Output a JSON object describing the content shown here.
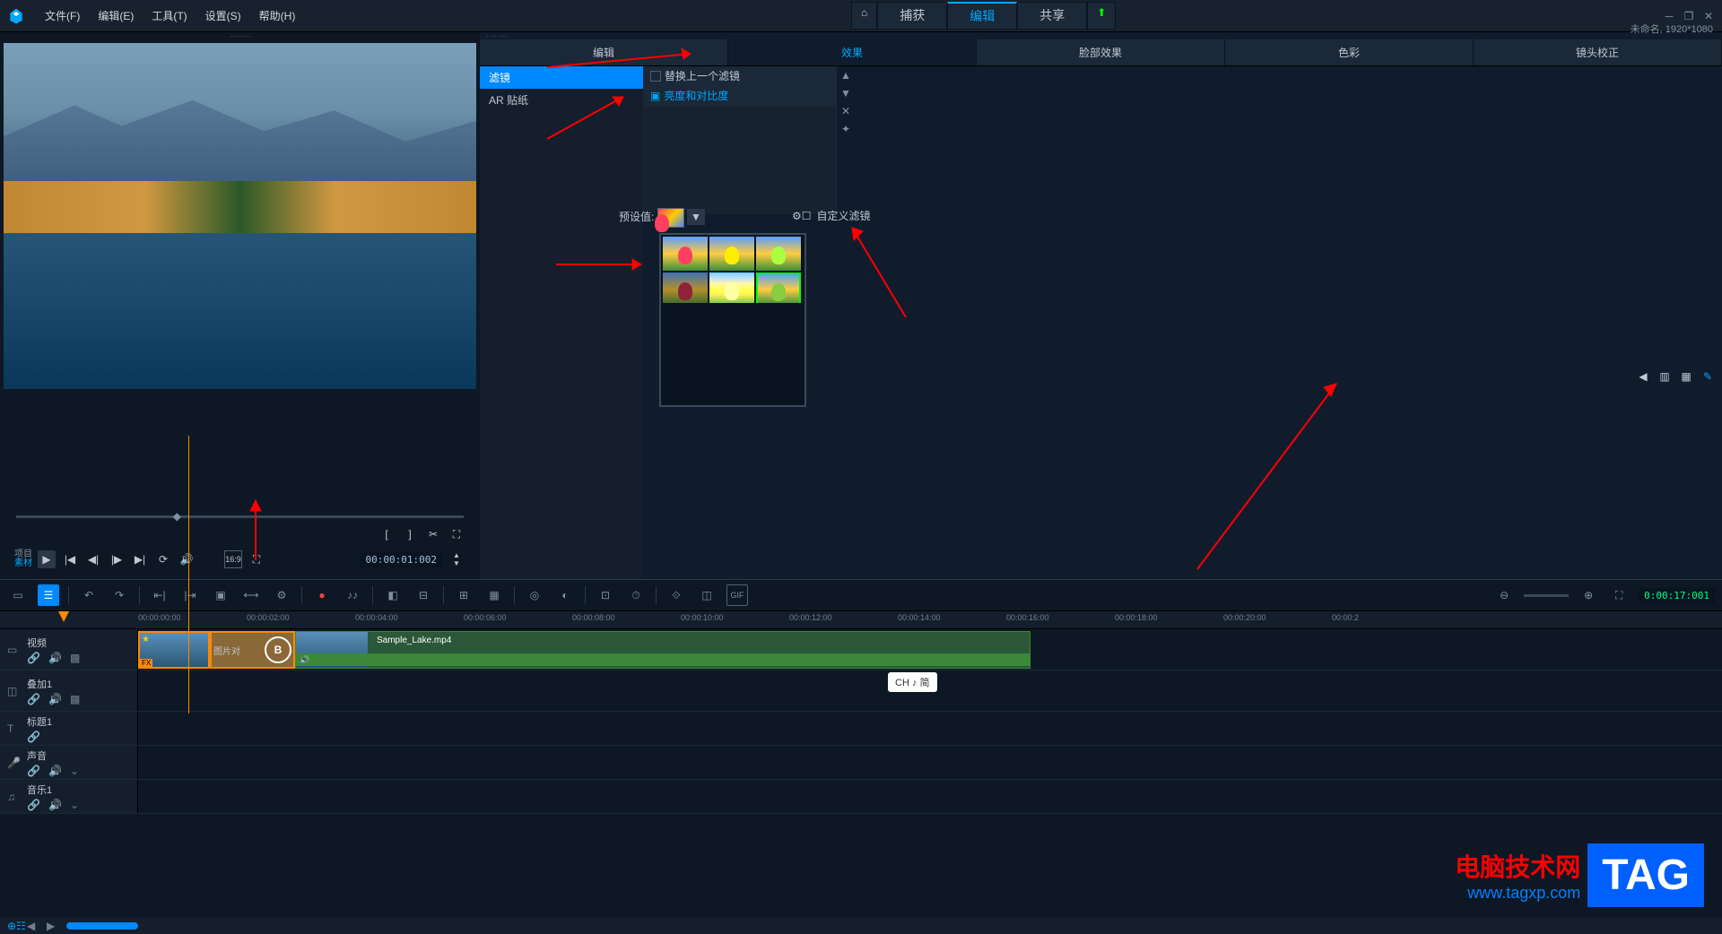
{
  "menubar": {
    "file": "文件(F)",
    "edit": "编辑(E)",
    "tools": "工具(T)",
    "settings": "设置(S)",
    "help": "帮助(H)"
  },
  "main_tabs": {
    "capture": "捕获",
    "edit": "编辑",
    "share": "共享"
  },
  "project_info": "未命名, 1920*1080",
  "preview": {
    "mode_project": "项目",
    "mode_clip": "素材",
    "aspect": "16:9",
    "timecode": "00:00:01:002"
  },
  "effect_tabs": {
    "edit": "编辑",
    "effect": "效果",
    "face": "脸部效果",
    "color": "色彩",
    "lens": "镜头校正"
  },
  "filter_cats": {
    "filter": "滤镜",
    "ar_sticker": "AR 贴纸"
  },
  "filter_opts": {
    "replace_last": "替换上一个滤镜",
    "brightness_contrast": "亮度和对比度"
  },
  "preset_label": "预设值:",
  "custom_filter_label": "自定义滤镜",
  "toolbar_time": "0:00:17:001",
  "ruler": {
    "t0": "00:00:00:00",
    "t1": "00:00:02:00",
    "t2": "00:00:04:00",
    "t3": "00:00:06:00",
    "t4": "00:00:08:00",
    "t5": "00:00:10:00",
    "t6": "00:00:12:00",
    "t7": "00:00:14:00",
    "t8": "00:00:16:00",
    "t9": "00:00:18:00",
    "t10": "00:00:20:00",
    "t11": "00:00:2"
  },
  "tracks": {
    "video": "视频",
    "overlay": "叠加1",
    "title": "标题1",
    "sound": "声音",
    "music": "音乐1"
  },
  "clips": {
    "image_clip": "图片对",
    "sample": "Sample_Lake.mp4"
  },
  "ime": "CH ♪ 简",
  "watermark": {
    "title": "电脑技术网",
    "url": "www.tagxp.com",
    "tag": "TAG"
  }
}
